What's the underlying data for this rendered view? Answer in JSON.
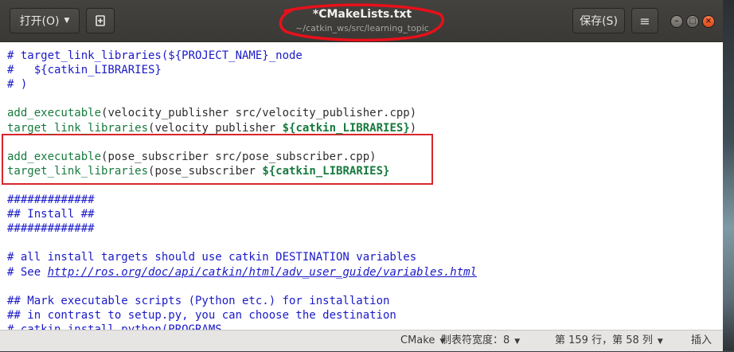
{
  "header": {
    "open_label": "打开(O)",
    "new_doc_icon": "new-document-icon",
    "title": "*CMakeLists.txt",
    "subtitle": "~/catkin_ws/src/learning_topic",
    "save_label": "保存(S)",
    "menu_icon": "hamburger-menu-icon"
  },
  "window_controls": {
    "minimize": "–",
    "maximize": "□",
    "close": "×"
  },
  "editor": {
    "lines": [
      [
        [
          "cm",
          "# target_link_libraries(${PROJECT_NAME}_node"
        ]
      ],
      [
        [
          "cm",
          "#   ${catkin_LIBRARIES}"
        ]
      ],
      [
        [
          "cm",
          "# )"
        ]
      ],
      [],
      [
        [
          "fn",
          "add_executable"
        ],
        [
          "tx",
          "(velocity_publisher src/velocity_publisher.cpp)"
        ]
      ],
      [
        [
          "fn",
          "target_link_libraries"
        ],
        [
          "tx",
          "(velocity_publisher "
        ],
        [
          "vr",
          "${"
        ],
        [
          "vr",
          "catkin_LIBRARIES"
        ],
        [
          "vr",
          "}"
        ],
        [
          "tx",
          ")"
        ]
      ],
      [],
      [
        [
          "fn",
          "add_executable"
        ],
        [
          "tx",
          "(pose_subscriber src/pose_subscriber.cpp)"
        ]
      ],
      [
        [
          "fn",
          "target_link_libraries"
        ],
        [
          "tx",
          "(pose_subscriber "
        ],
        [
          "vr",
          "${"
        ],
        [
          "vr",
          "catkin_LIBRARIES"
        ],
        [
          "vr",
          "}"
        ]
      ],
      [],
      [
        [
          "cm",
          "#############"
        ]
      ],
      [
        [
          "cm",
          "## Install ##"
        ]
      ],
      [
        [
          "cm",
          "#############"
        ]
      ],
      [],
      [
        [
          "cm",
          "# all install targets should use catkin DESTINATION variables"
        ]
      ],
      [
        [
          "cm",
          "# See "
        ],
        [
          "lk",
          "http://ros.org/doc/api/catkin/html/adv_user_guide/variables.html"
        ]
      ],
      [],
      [
        [
          "cm",
          "## Mark executable scripts (Python etc.) for installation"
        ]
      ],
      [
        [
          "cm",
          "## in contrast to setup.py, you can choose the destination"
        ]
      ],
      [
        [
          "cm",
          "# catkin_install_python(PROGRAMS"
        ]
      ]
    ]
  },
  "statusbar": {
    "language": "CMake",
    "tab_width": "制表符宽度：8",
    "position": "第 159 行，第 58 列",
    "mode": "插入"
  },
  "annotations": {
    "color": "#d8262c"
  }
}
